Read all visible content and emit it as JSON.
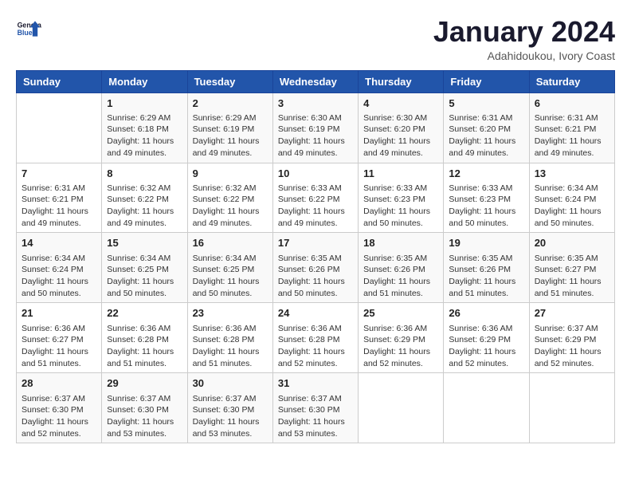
{
  "header": {
    "logo_general": "General",
    "logo_blue": "Blue",
    "month_year": "January 2024",
    "location": "Adahidoukou, Ivory Coast"
  },
  "days_of_week": [
    "Sunday",
    "Monday",
    "Tuesday",
    "Wednesday",
    "Thursday",
    "Friday",
    "Saturday"
  ],
  "weeks": [
    [
      {
        "day": "",
        "info": ""
      },
      {
        "day": "1",
        "info": "Sunrise: 6:29 AM\nSunset: 6:18 PM\nDaylight: 11 hours\nand 49 minutes."
      },
      {
        "day": "2",
        "info": "Sunrise: 6:29 AM\nSunset: 6:19 PM\nDaylight: 11 hours\nand 49 minutes."
      },
      {
        "day": "3",
        "info": "Sunrise: 6:30 AM\nSunset: 6:19 PM\nDaylight: 11 hours\nand 49 minutes."
      },
      {
        "day": "4",
        "info": "Sunrise: 6:30 AM\nSunset: 6:20 PM\nDaylight: 11 hours\nand 49 minutes."
      },
      {
        "day": "5",
        "info": "Sunrise: 6:31 AM\nSunset: 6:20 PM\nDaylight: 11 hours\nand 49 minutes."
      },
      {
        "day": "6",
        "info": "Sunrise: 6:31 AM\nSunset: 6:21 PM\nDaylight: 11 hours\nand 49 minutes."
      }
    ],
    [
      {
        "day": "7",
        "info": "Sunrise: 6:31 AM\nSunset: 6:21 PM\nDaylight: 11 hours\nand 49 minutes."
      },
      {
        "day": "8",
        "info": "Sunrise: 6:32 AM\nSunset: 6:22 PM\nDaylight: 11 hours\nand 49 minutes."
      },
      {
        "day": "9",
        "info": "Sunrise: 6:32 AM\nSunset: 6:22 PM\nDaylight: 11 hours\nand 49 minutes."
      },
      {
        "day": "10",
        "info": "Sunrise: 6:33 AM\nSunset: 6:22 PM\nDaylight: 11 hours\nand 49 minutes."
      },
      {
        "day": "11",
        "info": "Sunrise: 6:33 AM\nSunset: 6:23 PM\nDaylight: 11 hours\nand 50 minutes."
      },
      {
        "day": "12",
        "info": "Sunrise: 6:33 AM\nSunset: 6:23 PM\nDaylight: 11 hours\nand 50 minutes."
      },
      {
        "day": "13",
        "info": "Sunrise: 6:34 AM\nSunset: 6:24 PM\nDaylight: 11 hours\nand 50 minutes."
      }
    ],
    [
      {
        "day": "14",
        "info": "Sunrise: 6:34 AM\nSunset: 6:24 PM\nDaylight: 11 hours\nand 50 minutes."
      },
      {
        "day": "15",
        "info": "Sunrise: 6:34 AM\nSunset: 6:25 PM\nDaylight: 11 hours\nand 50 minutes."
      },
      {
        "day": "16",
        "info": "Sunrise: 6:34 AM\nSunset: 6:25 PM\nDaylight: 11 hours\nand 50 minutes."
      },
      {
        "day": "17",
        "info": "Sunrise: 6:35 AM\nSunset: 6:26 PM\nDaylight: 11 hours\nand 50 minutes."
      },
      {
        "day": "18",
        "info": "Sunrise: 6:35 AM\nSunset: 6:26 PM\nDaylight: 11 hours\nand 51 minutes."
      },
      {
        "day": "19",
        "info": "Sunrise: 6:35 AM\nSunset: 6:26 PM\nDaylight: 11 hours\nand 51 minutes."
      },
      {
        "day": "20",
        "info": "Sunrise: 6:35 AM\nSunset: 6:27 PM\nDaylight: 11 hours\nand 51 minutes."
      }
    ],
    [
      {
        "day": "21",
        "info": "Sunrise: 6:36 AM\nSunset: 6:27 PM\nDaylight: 11 hours\nand 51 minutes."
      },
      {
        "day": "22",
        "info": "Sunrise: 6:36 AM\nSunset: 6:28 PM\nDaylight: 11 hours\nand 51 minutes."
      },
      {
        "day": "23",
        "info": "Sunrise: 6:36 AM\nSunset: 6:28 PM\nDaylight: 11 hours\nand 51 minutes."
      },
      {
        "day": "24",
        "info": "Sunrise: 6:36 AM\nSunset: 6:28 PM\nDaylight: 11 hours\nand 52 minutes."
      },
      {
        "day": "25",
        "info": "Sunrise: 6:36 AM\nSunset: 6:29 PM\nDaylight: 11 hours\nand 52 minutes."
      },
      {
        "day": "26",
        "info": "Sunrise: 6:36 AM\nSunset: 6:29 PM\nDaylight: 11 hours\nand 52 minutes."
      },
      {
        "day": "27",
        "info": "Sunrise: 6:37 AM\nSunset: 6:29 PM\nDaylight: 11 hours\nand 52 minutes."
      }
    ],
    [
      {
        "day": "28",
        "info": "Sunrise: 6:37 AM\nSunset: 6:30 PM\nDaylight: 11 hours\nand 52 minutes."
      },
      {
        "day": "29",
        "info": "Sunrise: 6:37 AM\nSunset: 6:30 PM\nDaylight: 11 hours\nand 53 minutes."
      },
      {
        "day": "30",
        "info": "Sunrise: 6:37 AM\nSunset: 6:30 PM\nDaylight: 11 hours\nand 53 minutes."
      },
      {
        "day": "31",
        "info": "Sunrise: 6:37 AM\nSunset: 6:30 PM\nDaylight: 11 hours\nand 53 minutes."
      },
      {
        "day": "",
        "info": ""
      },
      {
        "day": "",
        "info": ""
      },
      {
        "day": "",
        "info": ""
      }
    ]
  ]
}
